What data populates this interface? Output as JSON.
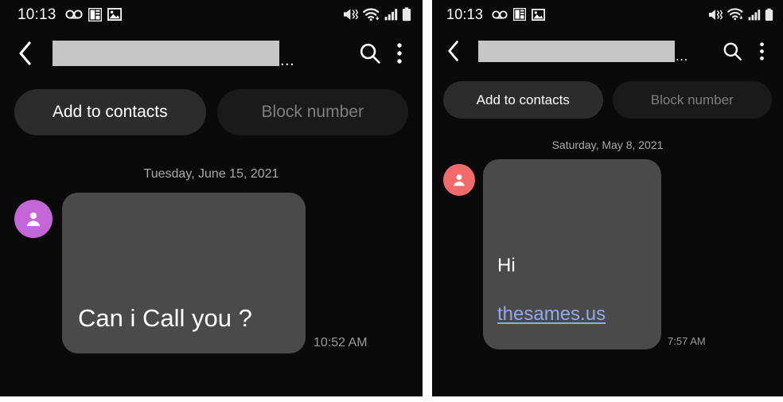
{
  "panels": [
    {
      "status_bar": {
        "clock": "10:13",
        "left_icons": [
          "voicemail-icon",
          "office-app-icon",
          "gallery-image-icon"
        ],
        "right_icons": [
          "mute-vibrate-icon",
          "wifi-icon",
          "cellular-signal-icon",
          "battery-icon"
        ]
      },
      "toolbar": {
        "back_icon": "back-chevron-icon",
        "title": "",
        "title_redacted": true,
        "title_ellipsis": "...",
        "search_icon": "search-icon",
        "menu_icon": "overflow-menu-icon"
      },
      "actions": {
        "add_to_contacts_label": "Add to contacts",
        "block_number_label": "Block number"
      },
      "conversation": {
        "date_separator": "Tuesday, June 15, 2021",
        "avatar_color": "#c466d8",
        "message_text": "Can i Call you ?",
        "message_link": "",
        "timestamp": "10:52 AM"
      }
    },
    {
      "status_bar": {
        "clock": "10:13",
        "left_icons": [
          "voicemail-icon",
          "office-app-icon",
          "gallery-image-icon"
        ],
        "right_icons": [
          "mute-vibrate-icon",
          "wifi-icon",
          "cellular-signal-icon",
          "battery-icon"
        ]
      },
      "toolbar": {
        "back_icon": "back-chevron-icon",
        "title": "",
        "title_redacted": true,
        "title_ellipsis": "...",
        "search_icon": "search-icon",
        "menu_icon": "overflow-menu-icon"
      },
      "actions": {
        "add_to_contacts_label": "Add to contacts",
        "block_number_label": "Block number"
      },
      "conversation": {
        "date_separator": "Saturday, May 8, 2021",
        "avatar_color": "#f26b6b",
        "message_text": "Hi",
        "message_link": "thesames.us",
        "timestamp": "7:57 AM"
      }
    }
  ],
  "colors": {
    "background": "#0a0a0a",
    "bubble": "#4a4a4a",
    "chip_primary": "#2c2c2c",
    "chip_secondary": "#1a1a1a",
    "chip_secondary_text": "#7e7e7e",
    "link": "#91a9e8",
    "redacted_bar": "#c6c6c6",
    "date_text": "#a9a9a9",
    "timestamp_text": "#9a9a9a",
    "divider": "#ffffff"
  }
}
